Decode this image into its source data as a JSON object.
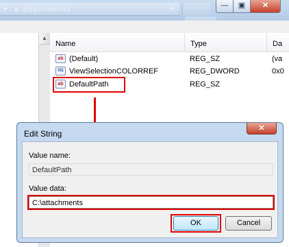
{
  "window": {
    "address_text": "▸  attachments",
    "minimize_glyph": "—",
    "maximize_glyph": "▣",
    "close_glyph": "✕",
    "scroll_up_glyph": "▲",
    "address_back_glyph": "◂",
    "address_chev_glyph": "▸"
  },
  "columns": [
    {
      "label": "Name"
    },
    {
      "label": "Type"
    },
    {
      "label": "Da"
    }
  ],
  "values": [
    {
      "name": "(Default)",
      "type": "REG_SZ",
      "data": "(va",
      "icon": "string-value-icon",
      "icon_text": "ab"
    },
    {
      "name": "ViewSelectionCOLORREF",
      "type": "REG_DWORD",
      "data": "0x0",
      "icon": "binary-value-icon",
      "icon_text": "011"
    },
    {
      "name": "DefaultPath",
      "type": "REG_SZ",
      "data": "",
      "icon": "string-value-icon",
      "icon_text": "ab"
    }
  ],
  "dialog": {
    "title": "Edit String",
    "close_glyph": "✕",
    "value_name_label": "Value name:",
    "value_name": "DefaultPath",
    "value_data_label": "Value data:",
    "value_data": "C:\\attachments",
    "ok_label": "OK",
    "cancel_label": "Cancel"
  },
  "colors": {
    "highlight": "#e00000",
    "ok_border": "#3c7fb1",
    "dialog_frame": "#c5d9f0"
  }
}
